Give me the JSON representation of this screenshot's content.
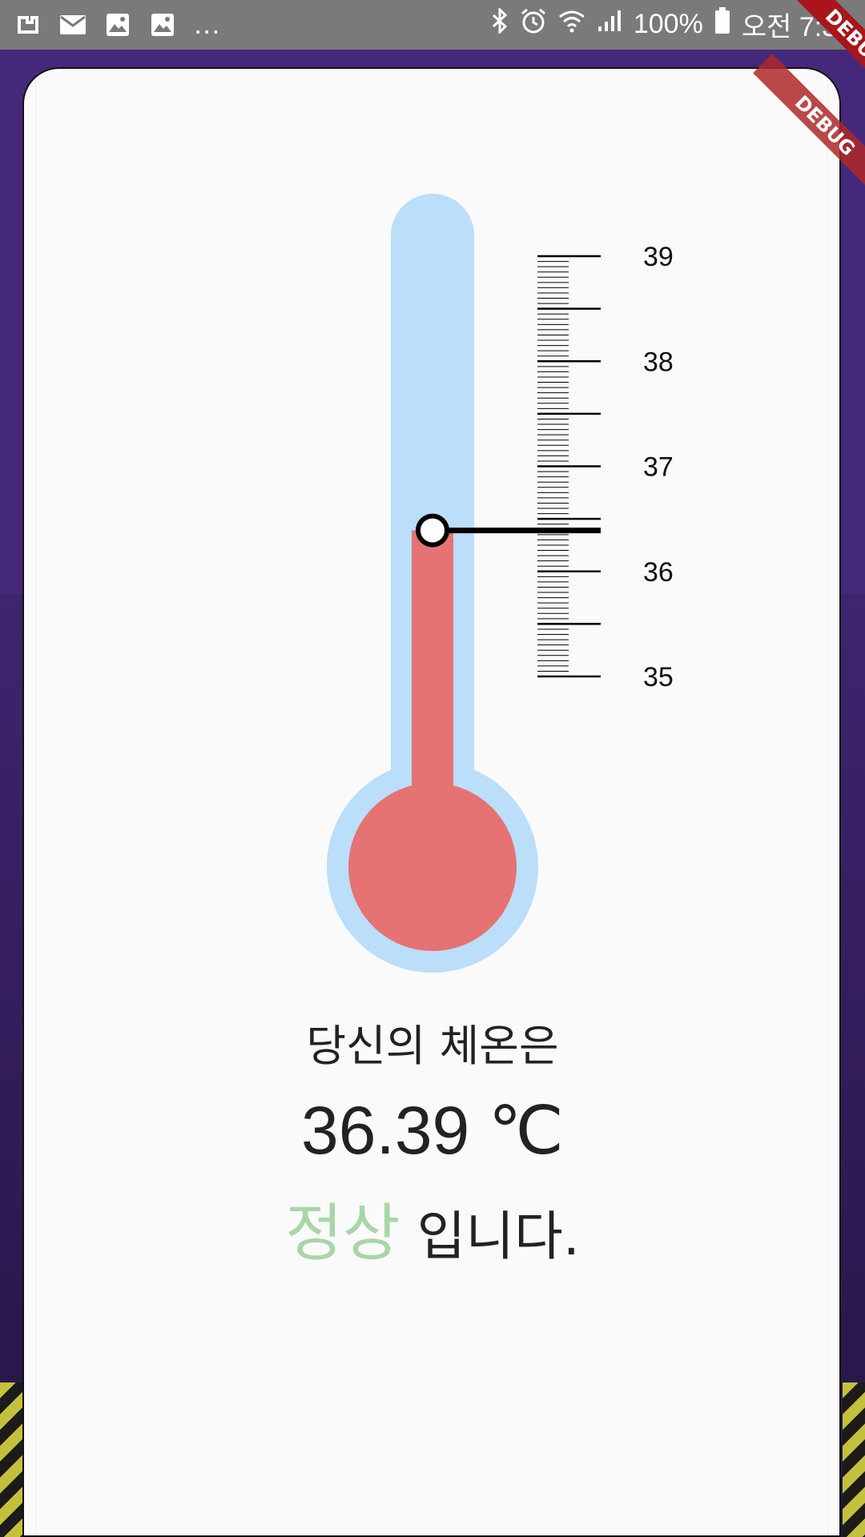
{
  "status_bar": {
    "left_icons": [
      "upload-cloud-icon",
      "mail-icon",
      "image-icon",
      "image-icon"
    ],
    "overflow": "...",
    "right_icons": [
      "bluetooth-icon",
      "alarm-icon",
      "wifi-icon",
      "signal-icon"
    ],
    "battery": "100%",
    "time": "오전 7:35"
  },
  "debug_label": "DEBUG",
  "thermometer": {
    "scale_min": 35,
    "scale_max": 39,
    "major_labels": [
      "39",
      "38",
      "37",
      "36",
      "35"
    ],
    "reading": 36.39,
    "colors": {
      "tube": "#bbdefa",
      "mercury": "#e57373",
      "marker": "#000000",
      "knob": "#ffffff"
    }
  },
  "result": {
    "intro": "당신의 체온은",
    "value": "36.39 ℃",
    "status": "정상",
    "suffix": " 입니다.",
    "status_color": "#a7d6a7"
  },
  "colors": {
    "background": "#46287a",
    "card": "#fafafa",
    "status_bar": "#7a7a7a"
  }
}
